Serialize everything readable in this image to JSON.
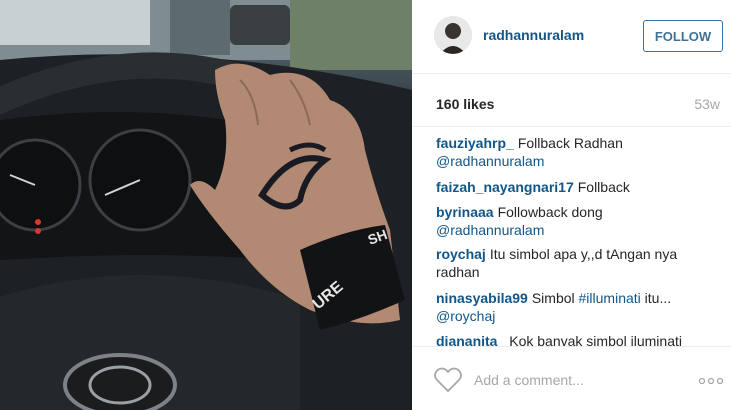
{
  "post": {
    "username": "radhannuralam",
    "follow_label": "FOLLOW",
    "likes": "160 likes",
    "age": "53w"
  },
  "comments": [
    {
      "user": "fauziyahrp_",
      "text": "Follback Radhan",
      "link": "@radhannuralam"
    },
    {
      "user": "faizah_nayangnari17",
      "text": "Follback"
    },
    {
      "user": "byrinaaa",
      "text": "Followback dong",
      "link": "@radhannuralam"
    },
    {
      "user": "roychaj",
      "text": "Itu simbol apa y,,d tAngan nya radhan"
    },
    {
      "user": "ninasyabila99",
      "text": "Simbol",
      "hashtag": "#illuminati",
      "tail": "itu...",
      "link": "@roychaj"
    },
    {
      "user": "diananita_",
      "text": "Kok banyak simbol iluminati"
    }
  ],
  "footer": {
    "comment_placeholder": "Add a comment..."
  },
  "icons": {
    "like": "heart-icon",
    "options": "more-options-icon"
  },
  "colors": {
    "username": "#125688",
    "follow_border": "#3f729b",
    "muted": "#a5a7aa"
  }
}
